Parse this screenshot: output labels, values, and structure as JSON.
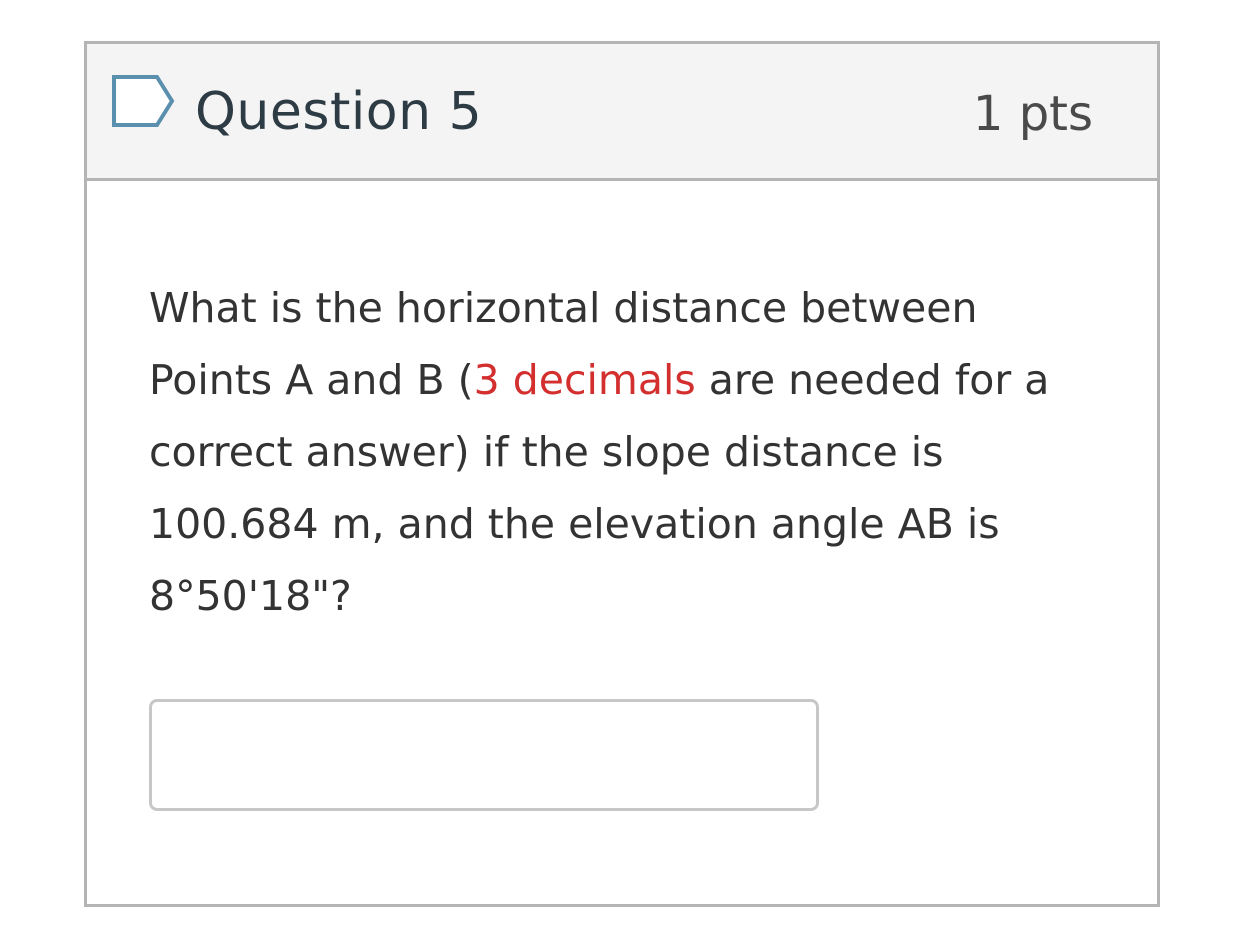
{
  "question": {
    "title": "Question 5",
    "points": "1 pts",
    "flag_icon": "bookmark-flag-icon",
    "text": {
      "part1": "What is the horizontal distance between Points A and B (",
      "highlight": "3 decimals",
      "part2": " are needed for a correct answer) if the slope distance is 100.684 m, and the elevation angle AB is 8°50'18\"?"
    },
    "answer": {
      "value": "",
      "placeholder": ""
    }
  },
  "colors": {
    "header_bg": "#f5f4f4",
    "border": "#b4b4b4",
    "highlight": "#d32f2f",
    "flag": "#5b8fae"
  }
}
